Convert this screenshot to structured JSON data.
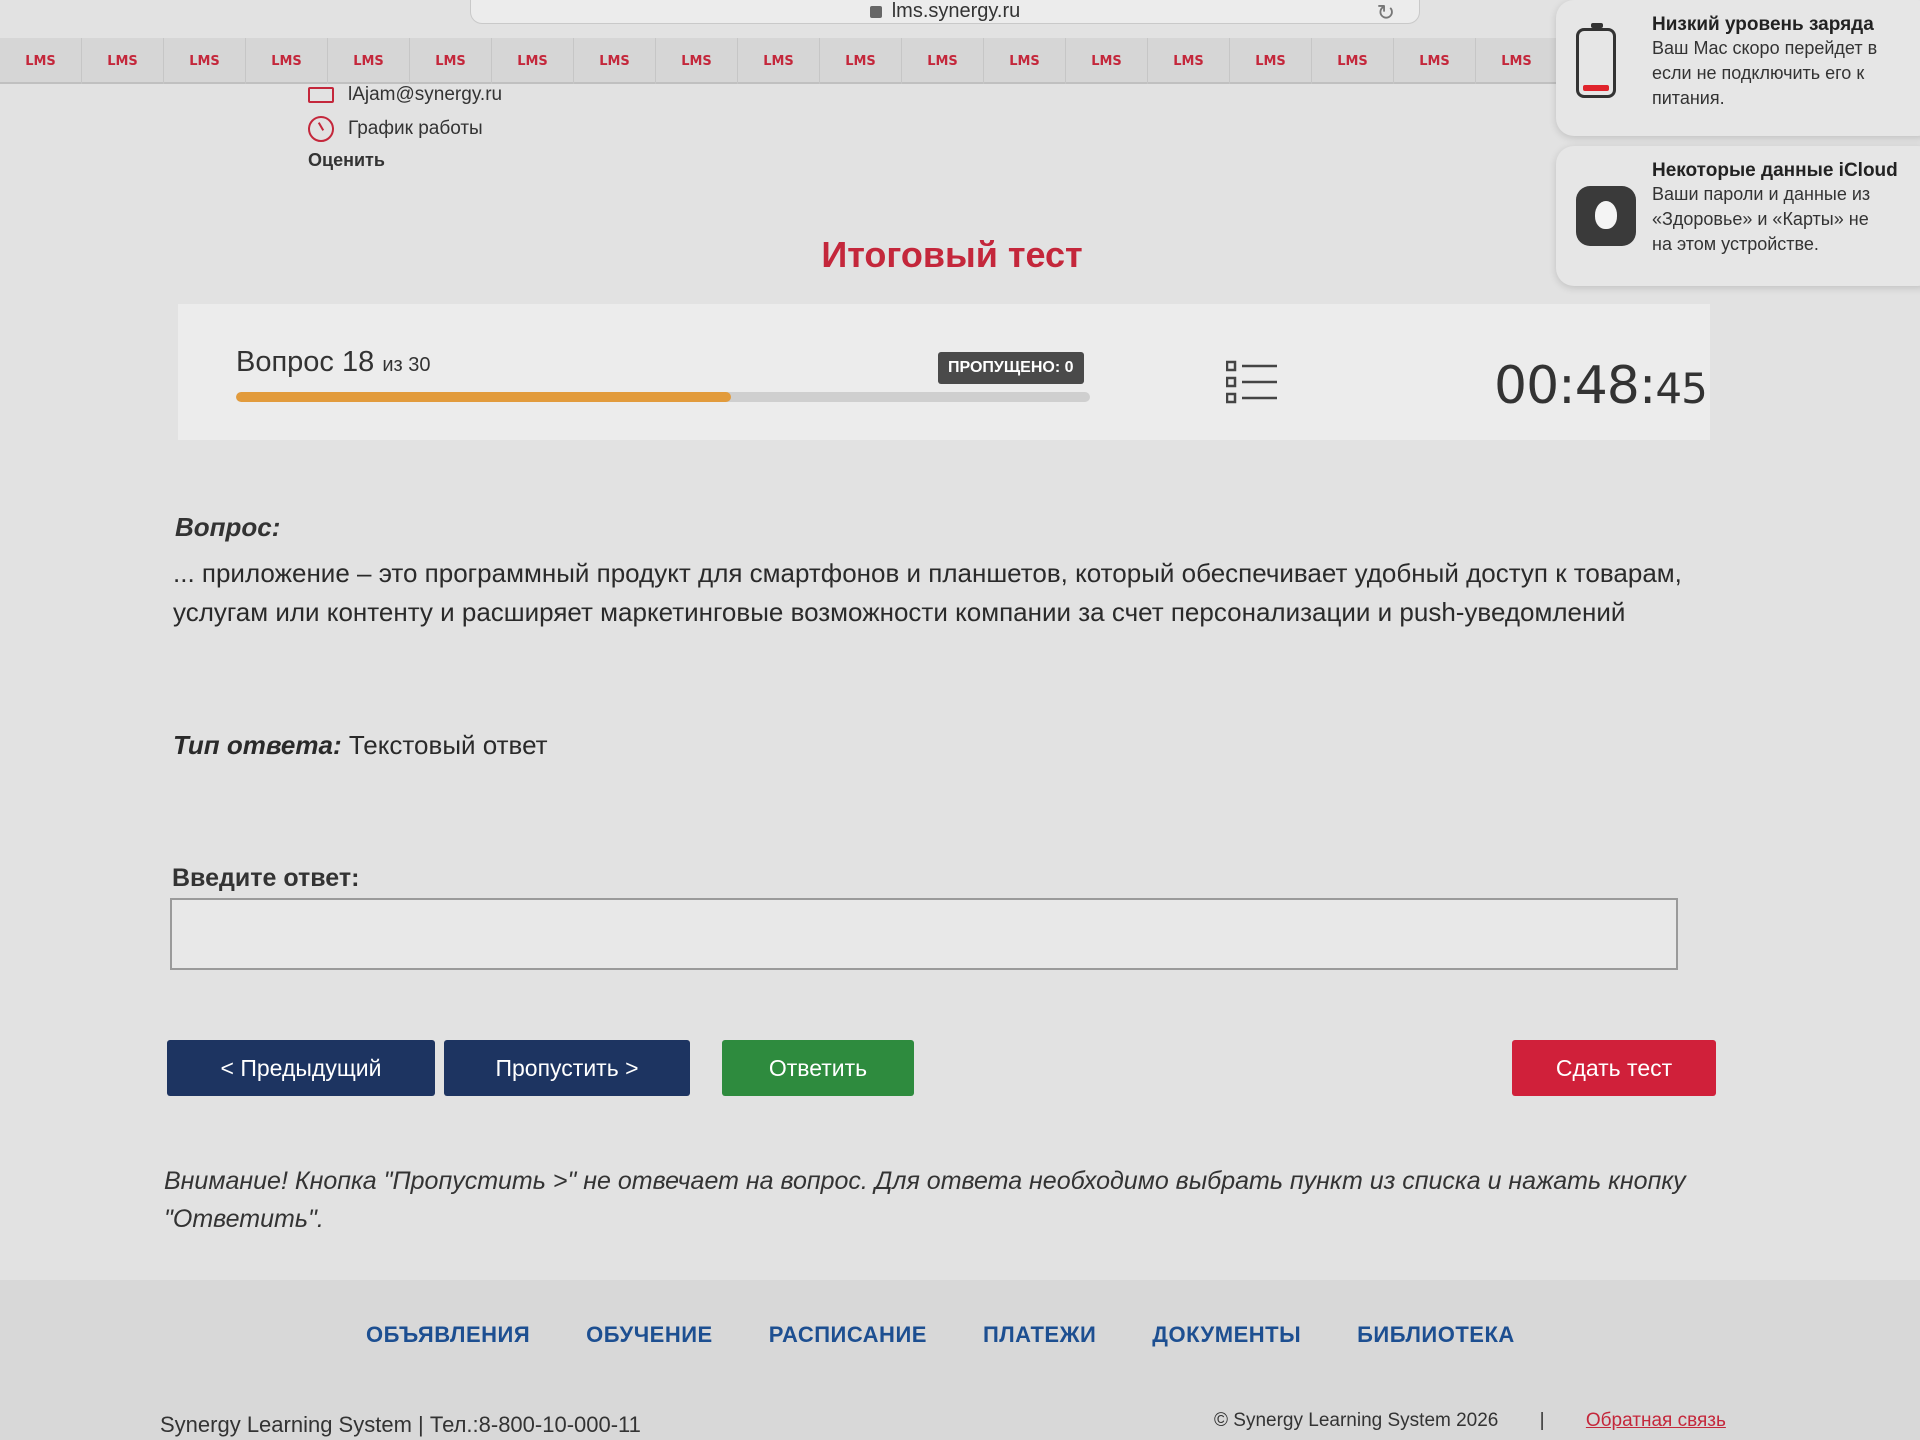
{
  "browser": {
    "url": "lms.synergy.ru"
  },
  "lms_strip": {
    "label": "LMS",
    "count": 19,
    "color": "#c4273b"
  },
  "contacts": {
    "email": "lAjam@synergy.ru",
    "schedule": "График работы",
    "rate": "Оценить"
  },
  "notifications": [
    {
      "title": "Низкий уровень заряда",
      "lines": [
        "Ваш Mac скоро перейдет в",
        "если не подключить его к",
        "питания."
      ],
      "icon": "battery-low-icon"
    },
    {
      "title": "Некоторые данные iCloud",
      "lines": [
        "Ваши пароли и данные из",
        "«Здоровье» и «Карты» не",
        "на этом устройстве."
      ],
      "icon": "apple-icon"
    }
  ],
  "page": {
    "title": "Итоговый тест"
  },
  "question_header": {
    "label": "Вопрос 18",
    "total": "из 30",
    "progress": 0.58,
    "skipped": "ПРОПУЩЕНО: 0",
    "timer_main": "00:48:",
    "timer_sec": "45"
  },
  "question": {
    "label": "Вопрос:",
    "text": "... приложение – это программный продукт для смартфонов и планшетов, который обеспечивает удобный доступ к товарам, услугам или контенту и расширяет маркетинговые возможности компании за счет персонализации и push-уведомлений",
    "answer_type_label": "Тип ответа:",
    "answer_type": "Текстовый ответ"
  },
  "answer": {
    "label": "Введите ответ:",
    "value": ""
  },
  "buttons": {
    "prev": "< Предыдущий",
    "skip": "Пропустить >",
    "answer": "Ответить",
    "submit": "Сдать тест"
  },
  "warning": "Внимание! Кнопка \"Пропустить >\" не отвечает на вопрос. Для ответа необходимо выбрать пункт из списка и нажать кнопку \"Ответить\".",
  "footer": {
    "nav": [
      "ОБЪЯВЛЕНИЯ",
      "ОБУЧЕНИЕ",
      "РАСПИСАНИЕ",
      "ПЛАТЕЖИ",
      "ДОКУМЕНТЫ",
      "БИБЛИОТЕКА"
    ],
    "brand": "Synergy Learning System",
    "phone": "Тел.:8-800-10-000-11",
    "copyright": "© Synergy Learning System 2026",
    "feedback": "Обратная связь"
  },
  "colors": {
    "brand_red": "#c4273b",
    "nav_blue": "#1d3461",
    "answer_green": "#2e8b3e",
    "submit_red": "#d0203a",
    "progress": "#e29b3c"
  }
}
